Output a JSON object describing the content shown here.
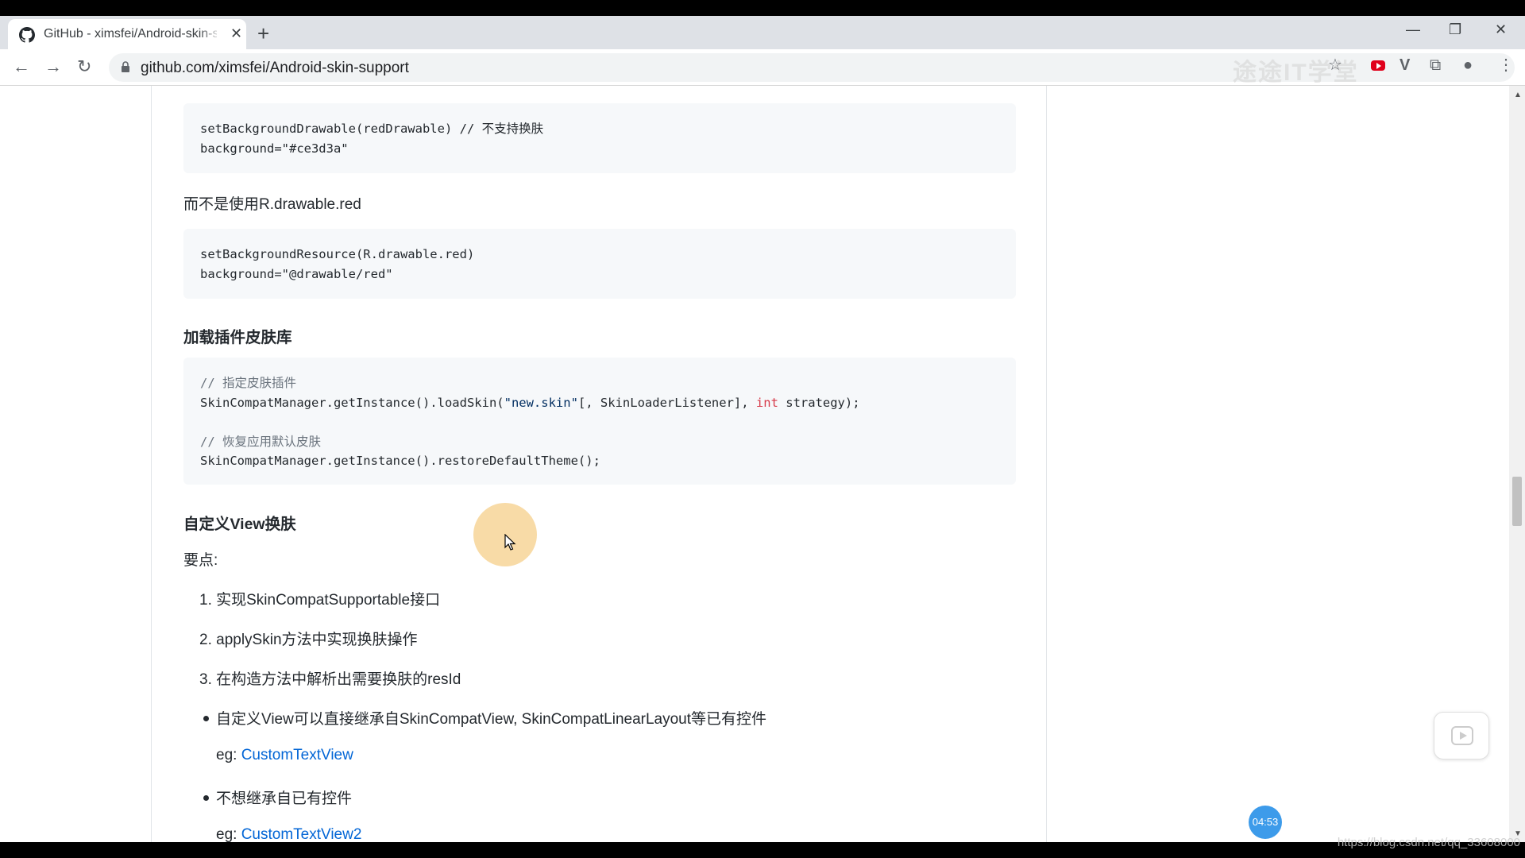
{
  "tab": {
    "title": "GitHub - ximsfei/Android-skin-support",
    "close": "✕"
  },
  "newtab": "+",
  "window": {
    "minimize": "—",
    "restore": "❐",
    "close": "✕"
  },
  "nav": {
    "back": "←",
    "forward": "→",
    "reload": "↻"
  },
  "address": {
    "url": "github.com/ximsfei/Android-skin-support"
  },
  "watermark": "途途IT学堂",
  "extensions": {
    "star": "☆",
    "vivaldi": "V",
    "puzzle": "⧉",
    "profile": "●",
    "menu": "⋮"
  },
  "content": {
    "code1": {
      "line1": "setBackgroundDrawable(redDrawable) // 不支持换肤",
      "line2": "background=\"#ce3d3a\""
    },
    "p1": "而不是使用R.drawable.red",
    "code2": {
      "line1": "setBackgroundResource(R.drawable.red)",
      "line2": "background=\"@drawable/red\""
    },
    "h_load": "加载插件皮肤库",
    "code3": {
      "c1": "// 指定皮肤插件",
      "l1a": "SkinCompatManager.getInstance().loadSkin(",
      "l1str": "\"new.skin\"",
      "l1b": "[, SkinLoaderListener], ",
      "l1kw": "int",
      "l1c": " strategy);",
      "c2": "// 恢复应用默认皮肤",
      "l2": "SkinCompatManager.getInstance().restoreDefaultTheme();"
    },
    "h_custom": "自定义View换肤",
    "key_points": "要点:",
    "ol": [
      "1. 实现SkinCompatSupportable接口",
      "2. applySkin方法中实现换肤操作",
      "3. 在构造方法中解析出需要换肤的resId"
    ],
    "ul1": "自定义View可以直接继承自SkinCompatView, SkinCompatLinearLayout等已有控件",
    "eg1_prefix": "eg: ",
    "eg1_link": "CustomTextView",
    "ul2": "不想继承自已有控件",
    "eg2_prefix": "eg: ",
    "eg2_link": "CustomTextView2"
  },
  "timer": "04:53",
  "csdn_watermark": "https://blog.csdn.net/qq_33608000"
}
